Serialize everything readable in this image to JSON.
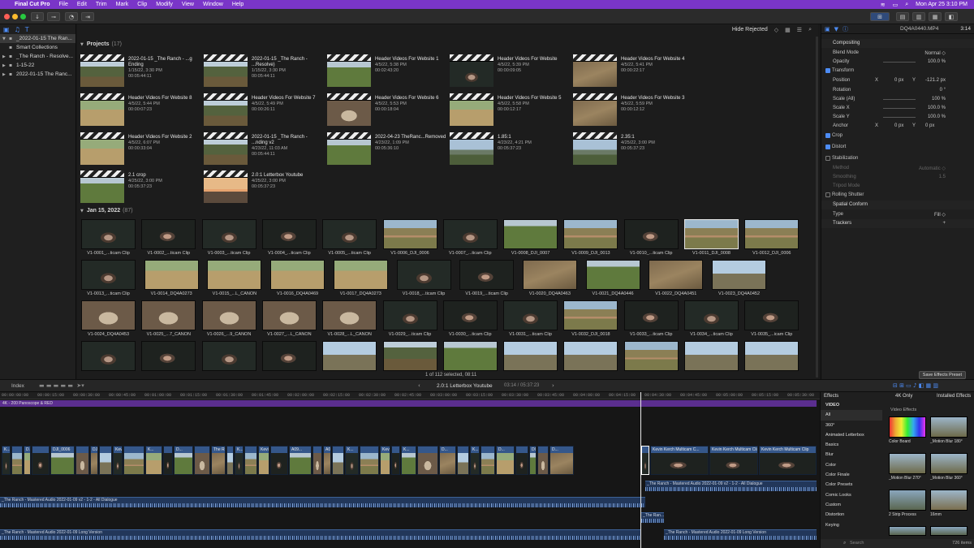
{
  "menubar": {
    "apple": "",
    "items": [
      "Final Cut Pro",
      "File",
      "Edit",
      "Trim",
      "Mark",
      "Clip",
      "Modify",
      "View",
      "Window",
      "Help"
    ],
    "datetime": "Mon Apr 25  3:10 PM"
  },
  "toolbar": {
    "import_icon": "↓",
    "keyword_icon": "⊸",
    "bg_icon": "◔",
    "share_icon": "⇥"
  },
  "library": {
    "items": [
      {
        "label": "_2022-01-15 The Ran...",
        "selected": true,
        "expanded": true
      },
      {
        "label": "Smart Collections",
        "selected": false
      },
      {
        "label": "_The Ranch - Resolve...",
        "selected": false
      },
      {
        "label": "1-15-22",
        "selected": false
      },
      {
        "label": "2022-01-15 The Ranc...",
        "selected": false
      }
    ]
  },
  "browser": {
    "filter": "Hide Rejected",
    "projects_title": "Projects",
    "projects_count": "(17)",
    "projects": [
      {
        "name": "2022-01-15 _The Ranch - ...g Ending",
        "date": "1/15/22, 3:30 PM",
        "dur": "00:05:44:11",
        "c": "c-wheel"
      },
      {
        "name": "2022-01-15 _The Ranch - ...Resolve)",
        "date": "1/15/22, 3:30 PM",
        "dur": "00:05:44:11",
        "c": "c-wheel"
      },
      {
        "name": "Header Videos For Website 1",
        "date": "4/5/22, 5:38 PM",
        "dur": "00:02:43:20",
        "c": "c-green"
      },
      {
        "name": "Header Videos For Website",
        "date": "4/5/22, 5:39 PM",
        "dur": "00:00:09:05",
        "c": "c-face"
      },
      {
        "name": "Header Videos For Website 4",
        "date": "4/5/22, 5:41 PM",
        "dur": "00:00:22:17",
        "c": "c-dirt"
      },
      {
        "name": "Header Videos For Website 8",
        "date": "4/5/22, 5:44 PM",
        "dur": "00:00:07:23",
        "c": "c-field"
      },
      {
        "name": "Header Videos For Website 7",
        "date": "4/5/22, 5:49 PM",
        "dur": "00:00:26:11",
        "c": "c-wheel"
      },
      {
        "name": "Header Videos For Website 6",
        "date": "4/5/22, 5:53 PM",
        "dur": "00:00:18:04",
        "c": "c-desk"
      },
      {
        "name": "Header Videos For Website 5",
        "date": "4/5/22, 5:58 PM",
        "dur": "00:00:12:17",
        "c": "c-field"
      },
      {
        "name": "Header Videos For Website 3",
        "date": "4/5/22, 5:59 PM",
        "dur": "00:00:12:12",
        "c": "c-dirt"
      },
      {
        "name": "Header Videos For Website 2",
        "date": "4/5/22, 6:07 PM",
        "dur": "00:00:33:04",
        "c": "c-field"
      },
      {
        "name": "2022-01-15 _The Ranch - ...nding v2",
        "date": "4/23/22, 11:03 AM",
        "dur": "00:05:44:11",
        "c": "c-wheel"
      },
      {
        "name": "2022-04-23 TheRanc...Removed",
        "date": "4/23/22, 1:09 PM",
        "dur": "00:05:36:10",
        "c": "c-green"
      },
      {
        "name": "1.85:1",
        "date": "4/23/22, 4:21 PM",
        "dur": "00:05:37:23",
        "c": "c-mtn"
      },
      {
        "name": "2.35:1",
        "date": "4/25/22, 3:00 PM",
        "dur": "00:05:37:23",
        "c": "c-mtn"
      },
      {
        "name": "2.1 crop",
        "date": "4/25/22, 3:00 PM",
        "dur": "00:05:37:23",
        "c": "c-green"
      },
      {
        "name": "2.0:1 Letterbox Youtube",
        "date": "4/25/22, 3:00 PM",
        "dur": "00:05:37:23",
        "c": "c-bike"
      }
    ],
    "events_title": "Jan 15, 2022",
    "events_count": "(87)",
    "clips": [
      {
        "label": "V1-0001_...ticam Clip",
        "c": "c-face"
      },
      {
        "label": "V1-0002_...ticam Clip",
        "c": "c-face2"
      },
      {
        "label": "V1-0003_...ticam Clip",
        "c": "c-face"
      },
      {
        "label": "V1-0004_...ticam Clip",
        "c": "c-face2"
      },
      {
        "label": "V1-0005_...ticam Clip",
        "c": "c-face"
      },
      {
        "label": "V1-0006_DJI_0006",
        "c": "c-road"
      },
      {
        "label": "V1-0007_...ticam Clip",
        "c": "c-face"
      },
      {
        "label": "V1-0008_DJI_0007",
        "c": "c-green"
      },
      {
        "label": "V1-0009_DJI_0013",
        "c": "c-road"
      },
      {
        "label": "V1-0010_...ticam Clip",
        "c": "c-face2"
      },
      {
        "label": "V1-0011_DJI_0008",
        "c": "c-road",
        "sel": true
      },
      {
        "label": "V1-0012_DJI_0006",
        "c": "c-road"
      },
      {
        "label": "V1-0013_...ticam Clip",
        "c": "c-face"
      },
      {
        "label": "V1-0014_DQ4A0273",
        "c": "c-field"
      },
      {
        "label": "V1-0015_...L_CANON",
        "c": "c-field"
      },
      {
        "label": "V1-0016_DQ4A0469",
        "c": "c-field"
      },
      {
        "label": "V1-0017_DQ4A0273",
        "c": "c-field"
      },
      {
        "label": "V1-0018_...ticam Clip",
        "c": "c-face"
      },
      {
        "label": "V1-0019_...ticam Clip",
        "c": "c-face2"
      },
      {
        "label": "V1-0020_DQ4A0463",
        "c": "c-dirt"
      },
      {
        "label": "V1-0021_DQ4A0446",
        "c": "c-green"
      },
      {
        "label": "V1-0022_DQ4A0451",
        "c": "c-dirt"
      },
      {
        "label": "V1-0023_DQ4A0452",
        "c": "c-sky"
      },
      {
        "label": "V1-0024_DQ4A0453",
        "c": "c-desk"
      },
      {
        "label": "V1-0025_...7_CANON",
        "c": "c-desk"
      },
      {
        "label": "V1-0026_...9_CANON",
        "c": "c-desk"
      },
      {
        "label": "V1-0027_...L_CANON",
        "c": "c-desk"
      },
      {
        "label": "V1-0028_...L_CANON",
        "c": "c-desk"
      },
      {
        "label": "V1-0029_...ticam Clip",
        "c": "c-face"
      },
      {
        "label": "V1-0030_...ticam Clip",
        "c": "c-face2"
      },
      {
        "label": "V1-0031_...ticam Clip",
        "c": "c-face"
      },
      {
        "label": "V1-0032_DJI_0018",
        "c": "c-road"
      },
      {
        "label": "V1-0033_...ticam Clip",
        "c": "c-face2"
      },
      {
        "label": "V1-0034_...ticam Clip",
        "c": "c-face"
      },
      {
        "label": "V1-0035_...icam Clip",
        "c": "c-face2"
      },
      {
        "label": "",
        "c": "c-face"
      },
      {
        "label": "",
        "c": "c-face2"
      },
      {
        "label": "",
        "c": "c-face"
      },
      {
        "label": "",
        "c": "c-face2"
      },
      {
        "label": "",
        "c": "c-sky"
      },
      {
        "label": "",
        "c": "c-wheel"
      },
      {
        "label": "",
        "c": "c-green"
      },
      {
        "label": "",
        "c": "c-sky"
      },
      {
        "label": "",
        "c": "c-sky"
      },
      {
        "label": "",
        "c": "c-road"
      },
      {
        "label": "",
        "c": "c-sky"
      },
      {
        "label": "",
        "c": "c-sky"
      },
      {
        "label": "",
        "c": "c-sky"
      },
      {
        "label": "",
        "c": "c-green"
      }
    ]
  },
  "inspector": {
    "filename": "DQ4A0440.MP4",
    "timecode": "3:14",
    "rows": [
      {
        "t": "h",
        "label": "Compositing"
      },
      {
        "t": "r",
        "label": "Blend Mode",
        "value": "Normal ◇"
      },
      {
        "t": "r",
        "label": "Opacity",
        "value": "100.0 %"
      },
      {
        "t": "c",
        "label": "Transform"
      },
      {
        "t": "r",
        "label": "Position",
        "x": "X",
        "xv": "0 px",
        "y": "Y",
        "yv": "-121.2 px"
      },
      {
        "t": "r",
        "label": "Rotation",
        "value": "0 °"
      },
      {
        "t": "r",
        "label": "Scale (All)",
        "value": "100 %"
      },
      {
        "t": "r",
        "label": "Scale X",
        "value": "100.0 %"
      },
      {
        "t": "r",
        "label": "Scale Y",
        "value": "100.0 %"
      },
      {
        "t": "r",
        "label": "Anchor",
        "x": "X",
        "xv": "0 px",
        "y": "Y",
        "yv": "0 px"
      },
      {
        "t": "c",
        "label": "Crop"
      },
      {
        "t": "c",
        "label": "Distort"
      },
      {
        "t": "o",
        "label": "Stabilization"
      },
      {
        "t": "d",
        "label": "Method",
        "value": "Automatic ◇"
      },
      {
        "t": "d",
        "label": "Smoothing",
        "value": "1.5"
      },
      {
        "t": "d",
        "label": "Tripod Mode",
        "value": ""
      },
      {
        "t": "o",
        "label": "Rolling Shutter"
      },
      {
        "t": "h",
        "label": "Spatial Conform"
      },
      {
        "t": "r",
        "label": "Type",
        "value": "Fill ◇"
      },
      {
        "t": "h",
        "label": "Trackers",
        "value": "+"
      }
    ],
    "save_preset": "Save Effects Preset"
  },
  "timeline": {
    "index": "Index",
    "selection": "1 of 112 selected, 08:11",
    "project": "2.0:1 Letterbox Youtube",
    "duration": "03:14 / 05:37:23",
    "purple_label": "4K - 200 Panoscope & RED",
    "ruler": [
      "00:00:00:00",
      "00:00:15:00",
      "00:00:30:00",
      "00:00:45:00",
      "00:01:00:00",
      "00:01:15:00",
      "00:01:30:00",
      "00:01:45:00",
      "00:02:00:00",
      "00:02:15:00",
      "00:02:30:00",
      "00:02:45:00",
      "00:03:00:00",
      "00:03:15:00",
      "00:03:30:00",
      "00:03:45:00",
      "00:04:00:00",
      "00:04:15:00",
      "00:04:30:00",
      "00:04:45:00",
      "00:05:00:00",
      "00:05:15:00",
      "00:05:30:00"
    ],
    "audio1": "_The Ranch - Mastered Audio 2022-01-09 v2 - 1-2 - All Dialogue",
    "audio1b": "_The Ranch - Mastered Audio 2022-01-09 v2 - 1-2 - All Dialogue",
    "audio2": "_The Ranch - Mastered Audio 2022-01-09 Long Version",
    "audio2b": "_The Ranch - Mastered Audio 2022-01-09 Long Version",
    "audio_mid": "_The Ran...",
    "clip_labels": [
      "K...",
      "D...",
      "DJI_0006",
      "DJI_...",
      "Kev...",
      "K...",
      "D...",
      "The Ran...",
      "K...",
      "Kevi...",
      "A09...",
      "A0...",
      "K...",
      "Kevin...",
      "K...",
      "D...",
      "K...",
      "D...",
      "DQ...",
      "D...",
      "K...",
      "Kevin Kerch Multicam C...",
      "Kevin Kerch Multicam Clip",
      "Kevin Kerch Multicam Clip",
      "Kevin Kerch Multicam..."
    ]
  },
  "effects": {
    "title": "Effects",
    "filter": "4K Only",
    "installed": "Installed Effects",
    "section": "Video Effects",
    "categories": [
      "VIDEO",
      "All",
      "360°",
      "Animated Letterbox",
      "Basics",
      "Blur",
      "Color",
      "Color Finale",
      "Color Presets",
      "Comic Looks",
      "Custom",
      "Distortion",
      "Keying"
    ],
    "items": [
      "Color Board",
      "_Motion Blur 180°",
      "_Motion Blur 270°",
      "_Motion Blur 360°",
      "2 Strip Process",
      "16mm"
    ],
    "search_placeholder": "Search",
    "count": "726 items"
  }
}
